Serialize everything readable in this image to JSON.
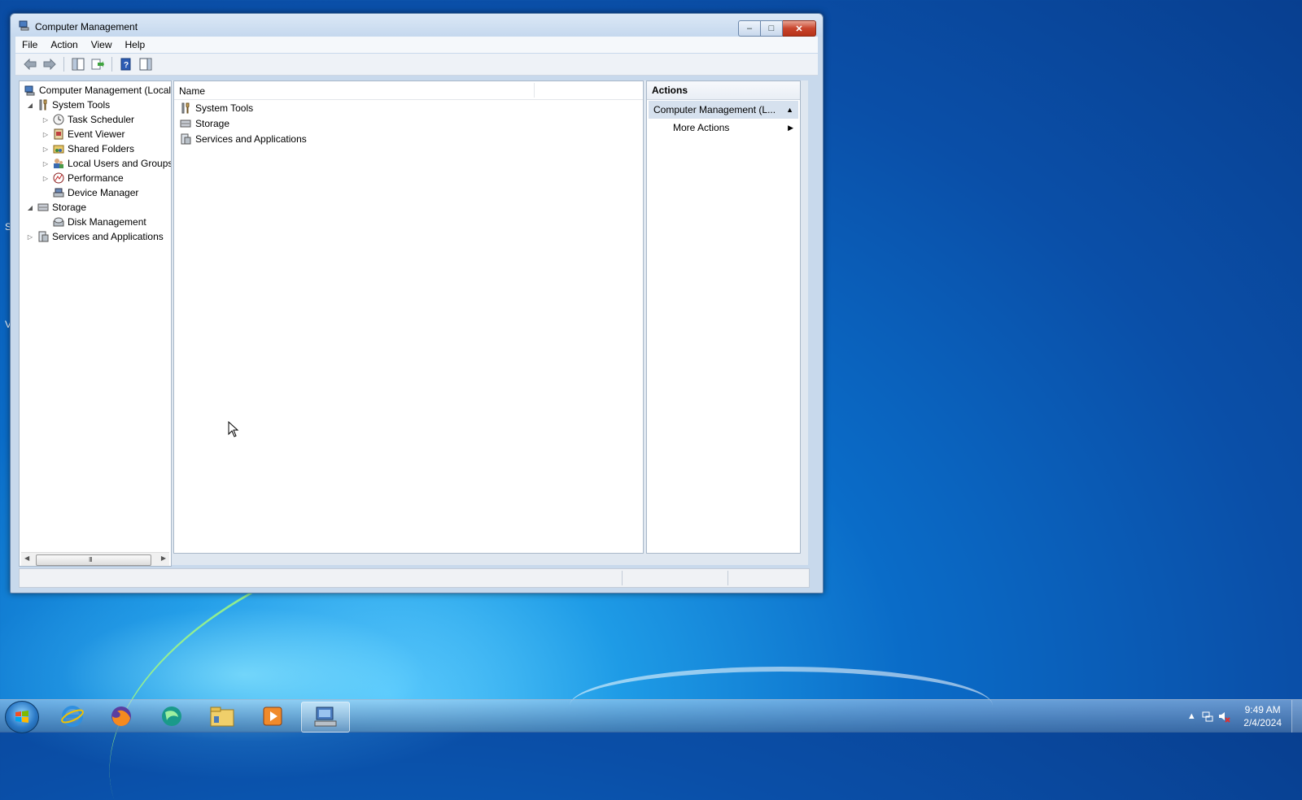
{
  "window": {
    "title": "Computer Management",
    "controls": {
      "minimize": "–",
      "maximize": "□",
      "close": "✕"
    }
  },
  "menu": [
    "File",
    "Action",
    "View",
    "Help"
  ],
  "toolbar": {
    "icons": [
      "back-icon",
      "forward-icon",
      "show-hide-console-tree-icon",
      "export-list-icon",
      "help-icon",
      "show-hide-action-pane-icon"
    ]
  },
  "tree": {
    "items": [
      {
        "label": "Computer Management (Local",
        "expander": "",
        "icon": "computer-management-icon"
      },
      {
        "label": "System Tools",
        "expander": "◢",
        "icon": "system-tools-icon"
      },
      {
        "label": "Task Scheduler",
        "expander": "▷",
        "icon": "task-scheduler-icon"
      },
      {
        "label": "Event Viewer",
        "expander": "▷",
        "icon": "event-viewer-icon"
      },
      {
        "label": "Shared Folders",
        "expander": "▷",
        "icon": "shared-folders-icon"
      },
      {
        "label": "Local Users and Groups",
        "expander": "▷",
        "icon": "local-users-icon"
      },
      {
        "label": "Performance",
        "expander": "▷",
        "icon": "performance-icon"
      },
      {
        "label": "Device Manager",
        "expander": "",
        "icon": "device-manager-icon"
      },
      {
        "label": "Storage",
        "expander": "◢",
        "icon": "storage-icon"
      },
      {
        "label": "Disk Management",
        "expander": "",
        "icon": "disk-management-icon"
      },
      {
        "label": "Services and Applications",
        "expander": "▷",
        "icon": "services-applications-icon"
      }
    ],
    "scroll_grip": "III"
  },
  "list": {
    "column_name": "Name",
    "rows": [
      {
        "label": "System Tools",
        "icon": "system-tools-icon"
      },
      {
        "label": "Storage",
        "icon": "storage-icon"
      },
      {
        "label": "Services and Applications",
        "icon": "services-applications-icon"
      }
    ]
  },
  "actions": {
    "title": "Actions",
    "section": "Computer Management (L...",
    "items": [
      "More Actions"
    ]
  },
  "desktop": {
    "edge_letters": [
      "S",
      "V"
    ]
  },
  "taskbar": {
    "apps": [
      "internet-explorer-icon",
      "firefox-icon",
      "browser-icon",
      "file-explorer-icon",
      "media-player-icon",
      "computer-management-icon"
    ],
    "clock_time": "9:49 AM",
    "clock_date": "2/4/2024"
  },
  "colors": {
    "desktop": "#0a6cc8",
    "selected_section": "#d6e1ee",
    "close_button": "#c8442c"
  }
}
